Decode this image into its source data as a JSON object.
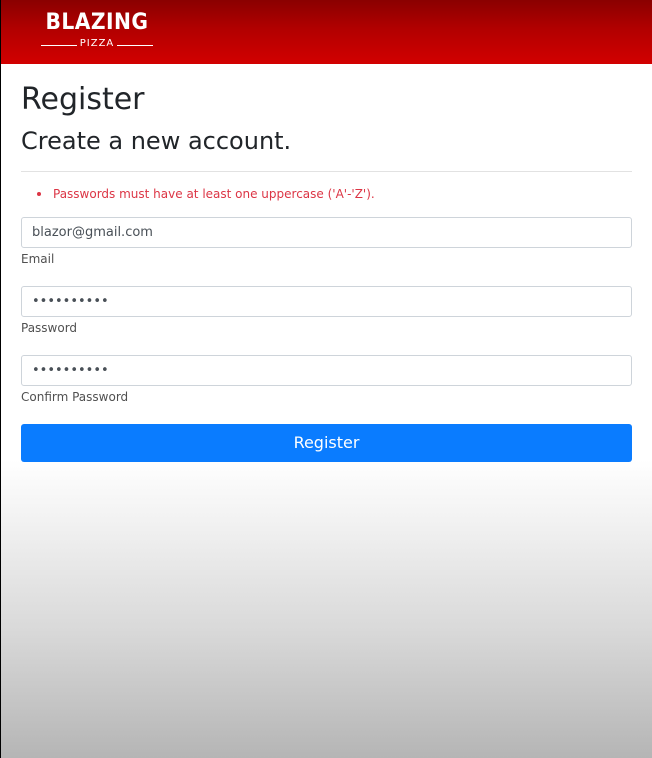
{
  "brand": {
    "name": "BLAZING",
    "tagline": "PIZZA",
    "colors": {
      "header_dark": "#8a0000",
      "header_light": "#d20000",
      "primary_button": "#0a7cff",
      "error": "#dc3545"
    }
  },
  "page": {
    "title": "Register",
    "subtitle": "Create a new account."
  },
  "validation": {
    "errors": [
      "Passwords must have at least one uppercase ('A'-'Z')."
    ]
  },
  "form": {
    "email": {
      "value": "blazor@gmail.com",
      "label": "Email"
    },
    "password": {
      "value": "••••••••••",
      "label": "Password"
    },
    "confirm_password": {
      "value": "••••••••••",
      "label": "Confirm Password"
    },
    "submit_label": "Register"
  }
}
